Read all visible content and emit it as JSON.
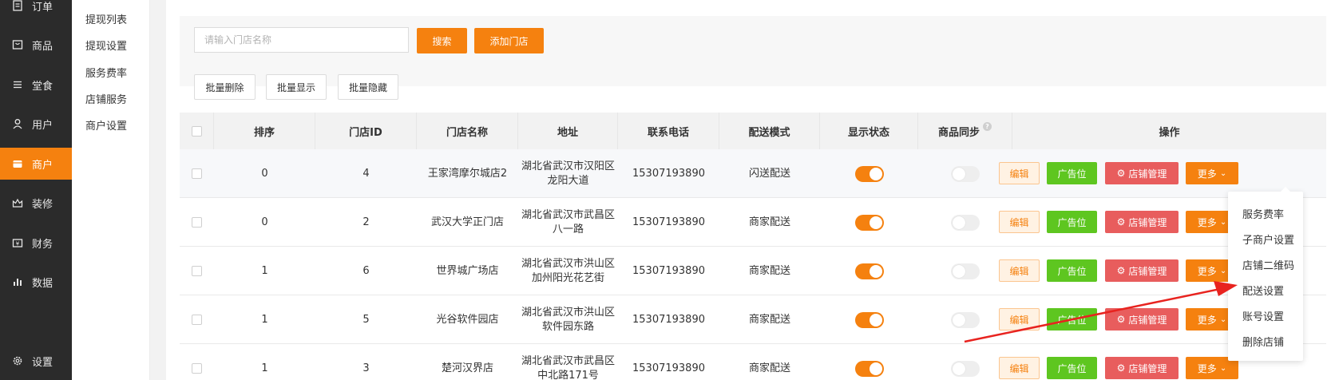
{
  "nav": {
    "items": [
      {
        "label": "订单",
        "icon": "order-icon"
      },
      {
        "label": "商品",
        "icon": "goods-icon"
      },
      {
        "label": "堂食",
        "icon": "dine-in-icon"
      },
      {
        "label": "用户",
        "icon": "user-icon"
      },
      {
        "label": "商户",
        "icon": "merchant-icon"
      },
      {
        "label": "装修",
        "icon": "decorate-icon"
      },
      {
        "label": "财务",
        "icon": "finance-icon"
      },
      {
        "label": "数据",
        "icon": "data-icon"
      },
      {
        "label": "设置",
        "icon": "settings-icon"
      }
    ],
    "active": "商户"
  },
  "subnav": {
    "items": [
      "提现列表",
      "提现设置",
      "服务费率",
      "店铺服务",
      "商户设置"
    ]
  },
  "search": {
    "placeholder": "请输入门店名称",
    "search_label": "搜索",
    "add_label": "添加门店"
  },
  "batch": {
    "delete_label": "批量删除",
    "show_label": "批量显示",
    "hide_label": "批量隐藏"
  },
  "table": {
    "headers": {
      "sort": "排序",
      "id": "门店ID",
      "name": "门店名称",
      "address": "地址",
      "phone": "联系电话",
      "delivery": "配送模式",
      "display": "显示状态",
      "sync": "商品同步",
      "ops": "操作"
    },
    "rows": [
      {
        "sort": "0",
        "id": "4",
        "name": "王家湾摩尔城店2",
        "addr1": "湖北省武汉市汉阳区",
        "addr2": "龙阳大道",
        "phone": "15307193890",
        "delivery": "闪送配送",
        "display_on": true,
        "sync_on": false
      },
      {
        "sort": "0",
        "id": "2",
        "name": "武汉大学正门店",
        "addr1": "湖北省武汉市武昌区",
        "addr2": "八一路",
        "phone": "15307193890",
        "delivery": "商家配送",
        "display_on": true,
        "sync_on": false
      },
      {
        "sort": "1",
        "id": "6",
        "name": "世界城广场店",
        "addr1": "湖北省武汉市洪山区",
        "addr2": "加州阳光花艺街",
        "phone": "15307193890",
        "delivery": "商家配送",
        "display_on": true,
        "sync_on": false
      },
      {
        "sort": "1",
        "id": "5",
        "name": "光谷软件园店",
        "addr1": "湖北省武汉市洪山区",
        "addr2": "软件园东路",
        "phone": "15307193890",
        "delivery": "商家配送",
        "display_on": true,
        "sync_on": false
      },
      {
        "sort": "1",
        "id": "3",
        "name": "楚河汉界店",
        "addr1": "湖北省武汉市武昌区",
        "addr2": "中北路171号",
        "phone": "15307193890",
        "delivery": "商家配送",
        "display_on": true,
        "sync_on": false
      }
    ],
    "ops": {
      "edit": "编辑",
      "ad": "广告位",
      "shop": "店铺管理",
      "more": "更多"
    }
  },
  "dropdown": {
    "items": [
      "服务费率",
      "子商户设置",
      "店铺二维码",
      "配送设置",
      "账号设置",
      "删除店铺"
    ]
  },
  "colors": {
    "accent": "#f5810f",
    "green": "#5ec620",
    "red": "#e85d5d",
    "annotation_arrow": "#e8231f"
  }
}
